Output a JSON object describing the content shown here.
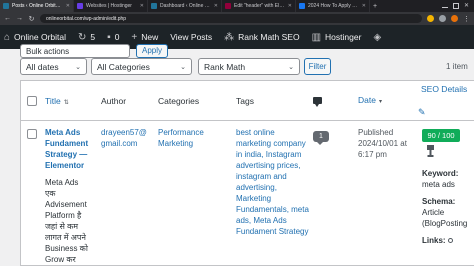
{
  "browser": {
    "tabs": [
      {
        "title": "Posts ‹ Online Orbital — Word…",
        "color": "#21759b",
        "active": true
      },
      {
        "title": "Websites | Hostinger",
        "color": "#673de6",
        "active": false
      },
      {
        "title": "Dashboard ‹ Online Orbital —",
        "color": "#21759b",
        "active": false
      },
      {
        "title": "Edit \"header\" with Elementor",
        "color": "#92003b",
        "active": false
      },
      {
        "title": "2024 How To Apply Meta Ads…",
        "color": "#1877f2",
        "active": false
      }
    ],
    "new_tab_icon": "plus-icon",
    "url": "onlineorbital.com/wp-admin/edit.php"
  },
  "admin_bar": {
    "site_name": "Online Orbital",
    "updates_count": "5",
    "comments_count": "0",
    "new_label": "New",
    "view_posts_label": "View Posts",
    "rank_math_label": "Rank Math SEO",
    "hostinger_label": "Hostinger"
  },
  "toolbar": {
    "bulk_actions": "Bulk actions",
    "apply_label": "Apply",
    "dates_filter": "All dates",
    "categories_filter": "All Categories",
    "rank_math_filter": "Rank Math",
    "filter_label": "Filter",
    "items_count": "1 item"
  },
  "table": {
    "columns": {
      "title": "Title",
      "author": "Author",
      "categories": "Categories",
      "tags": "Tags",
      "date": "Date",
      "seo_details": "SEO Details"
    },
    "row": {
      "title_lines": [
        "Meta Ads",
        "Fundament",
        "Strategy —",
        "Elementor"
      ],
      "excerpt_lines": [
        "Meta Ads",
        "एक",
        "Advisement",
        "Platform है",
        "जहां से कम",
        "लागत में अपने",
        "Business को",
        "Grow कर"
      ],
      "author_lines": [
        "drayeen57@",
        "gmail.com"
      ],
      "category_lines": [
        "Performance",
        "Marketing"
      ],
      "tags_lines": [
        "best online",
        "marketing company",
        "in india, Instagram",
        "advertising prices,",
        "instagram and",
        "advertising,",
        "Marketing",
        "Fundamentals, meta",
        "ads, Meta Ads",
        "Fundament Strategy"
      ],
      "comments": "1",
      "date_lines": [
        "Published",
        "2024/10/01 at",
        "6:17 pm"
      ],
      "seo_score": "90 / 100",
      "keyword_label": "Keyword:",
      "keyword_value": "meta ads",
      "schema_label": "Schema:",
      "schema_value_lines": [
        "Article",
        "(BlogPosting"
      ],
      "links_label": "Links:"
    }
  },
  "colors": {
    "admin_bar": "#1d2327",
    "link": "#2271b1",
    "seo_good": "#10ac59",
    "trophy": "#50575e"
  }
}
